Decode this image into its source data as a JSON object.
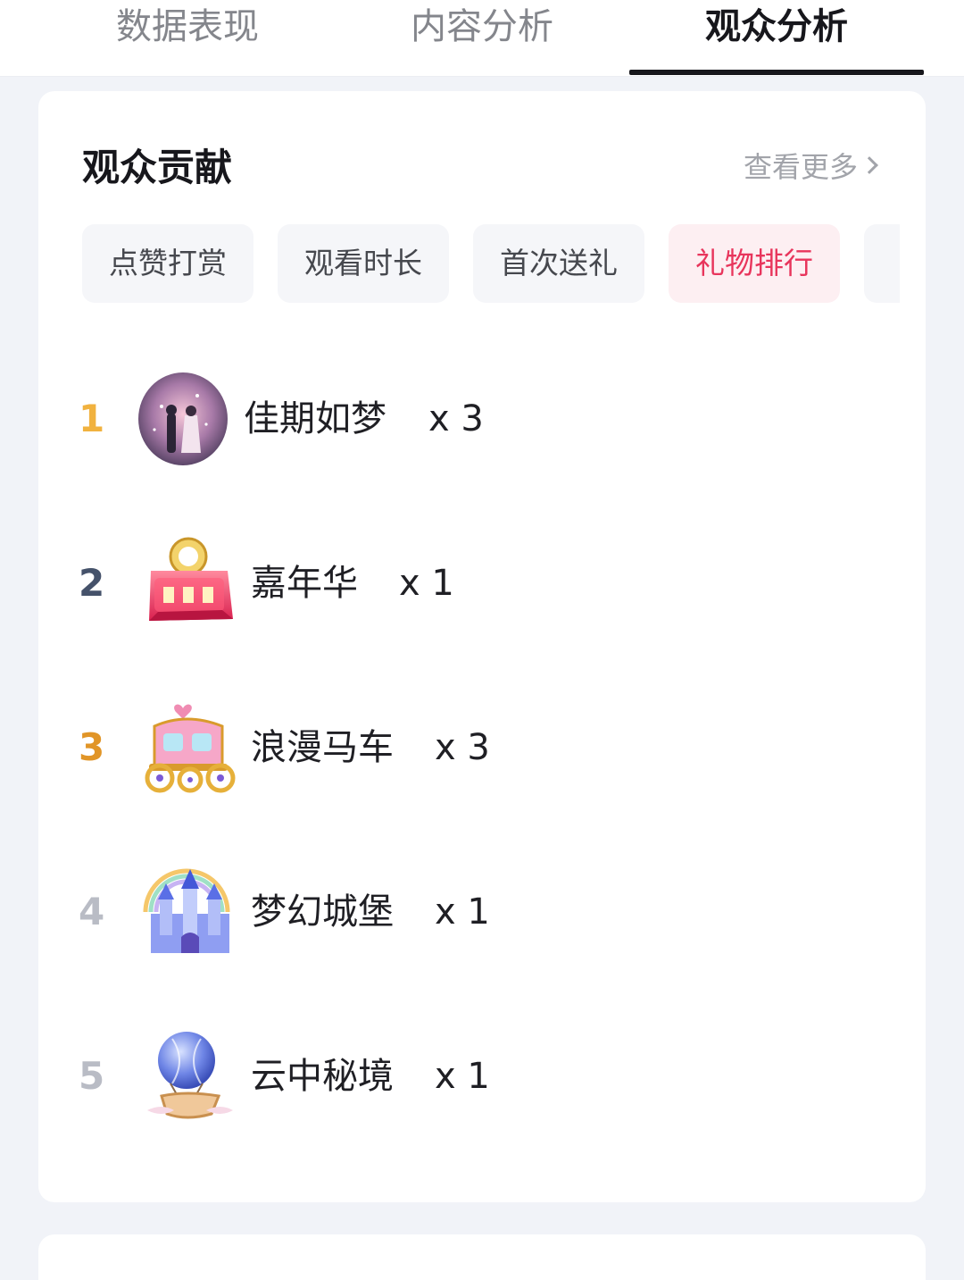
{
  "tabs": [
    {
      "label": "数据表现",
      "active": false
    },
    {
      "label": "内容分析",
      "active": false
    },
    {
      "label": "观众分析",
      "active": true
    }
  ],
  "section": {
    "title": "观众贡献",
    "more_label": "查看更多"
  },
  "filters": [
    {
      "label": "点赞打赏",
      "active": false
    },
    {
      "label": "观看时长",
      "active": false
    },
    {
      "label": "首次送礼",
      "active": false
    },
    {
      "label": "礼物排行",
      "active": true
    }
  ],
  "gift_ranking": [
    {
      "rank": "1",
      "name": "佳期如梦",
      "count": "x 3",
      "icon": "couple-portrait-gift-icon"
    },
    {
      "rank": "2",
      "name": "嘉年华",
      "count": "x 1",
      "icon": "carnival-badge-gift-icon"
    },
    {
      "rank": "3",
      "name": "浪漫马车",
      "count": "x 3",
      "icon": "carriage-gift-icon"
    },
    {
      "rank": "4",
      "name": "梦幻城堡",
      "count": "x 1",
      "icon": "castle-gift-icon"
    },
    {
      "rank": "5",
      "name": "云中秘境",
      "count": "x 1",
      "icon": "balloon-gift-icon"
    }
  ],
  "colors": {
    "active_filter": "#e8355c",
    "rank_gold": "#f1b23f",
    "rank_silver": "#45526a",
    "rank_bronze": "#e19527",
    "rank_default": "#b9bcc5"
  }
}
